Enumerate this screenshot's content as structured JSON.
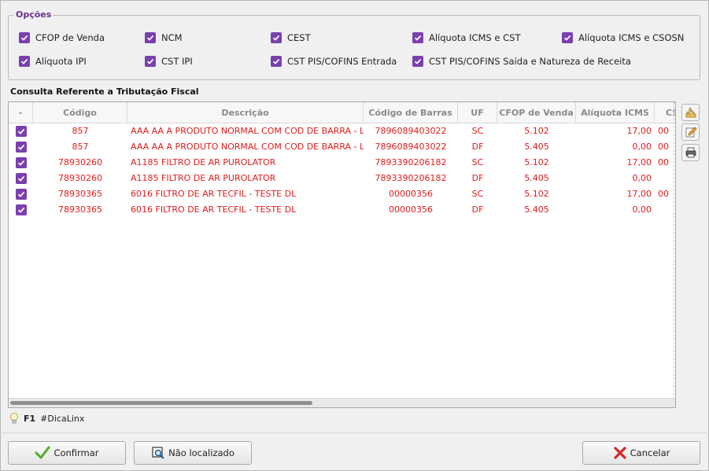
{
  "options": {
    "legend": "Opções",
    "items": [
      {
        "label": "CFOP de Venda",
        "checked": true
      },
      {
        "label": "NCM",
        "checked": true
      },
      {
        "label": "CEST",
        "checked": true
      },
      {
        "label": "Alíquota ICMS e CST",
        "checked": true
      },
      {
        "label": "Alíquota ICMS e CSOSN",
        "checked": true
      },
      {
        "label": "Alíquota IPI",
        "checked": true
      },
      {
        "label": "CST IPI",
        "checked": true
      },
      {
        "label": "CST PIS/COFINS Entrada",
        "checked": true
      },
      {
        "label": "CST PIS/COFINS Saída e Natureza de Receita",
        "checked": true
      }
    ]
  },
  "section_title": "Consulta Referente a Tributação Fiscal",
  "grid": {
    "headers": [
      "-",
      "Código",
      "Descrição",
      "Código de Barras",
      "UF",
      "CFOP de Venda",
      "Alíquota ICMS",
      "CS"
    ],
    "rows": [
      {
        "checked": true,
        "codigo": "857",
        "descricao": "AAA AA A PRODUTO NORMAL COM COD DE BARRA - L",
        "barras": "7896089403022",
        "uf": "SC",
        "cfop": "5.102",
        "aliquota": "17,00",
        "cs": "00"
      },
      {
        "checked": true,
        "codigo": "857",
        "descricao": "AAA AA A PRODUTO NORMAL COM COD DE BARRA - L",
        "barras": "7896089403022",
        "uf": "DF",
        "cfop": "5.405",
        "aliquota": "0,00",
        "cs": "00"
      },
      {
        "checked": true,
        "codigo": "78930260",
        "descricao": "A1185 FILTRO DE AR PUROLATOR",
        "barras": "7893390206182",
        "uf": "SC",
        "cfop": "5.102",
        "aliquota": "17,00",
        "cs": "00"
      },
      {
        "checked": true,
        "codigo": "78930260",
        "descricao": "A1185 FILTRO DE AR PUROLATOR",
        "barras": "7893390206182",
        "uf": "DF",
        "cfop": "5.405",
        "aliquota": "0,00",
        "cs": ""
      },
      {
        "checked": true,
        "codigo": "78930365",
        "descricao": "6016 FILTRO DE AR TECFIL - TESTE DL",
        "barras": "00000356",
        "uf": "SC",
        "cfop": "5.102",
        "aliquota": "17,00",
        "cs": "00"
      },
      {
        "checked": true,
        "codigo": "78930365",
        "descricao": "6016 FILTRO DE AR TECFIL - TESTE DL",
        "barras": "00000356",
        "uf": "DF",
        "cfop": "5.405",
        "aliquota": "0,00",
        "cs": ""
      }
    ]
  },
  "side_buttons": [
    "hand-pointer-icon",
    "edit-pencil-icon",
    "print-icon"
  ],
  "tip": {
    "key": "F1",
    "text": "#DicaLinx"
  },
  "buttons": {
    "confirm": "Confirmar",
    "not_found": "Não localizado",
    "cancel": "Cancelar"
  },
  "colors": {
    "accent": "#7b3fb0",
    "row_text": "#e11b1b",
    "legend": "#6b2f8f"
  }
}
